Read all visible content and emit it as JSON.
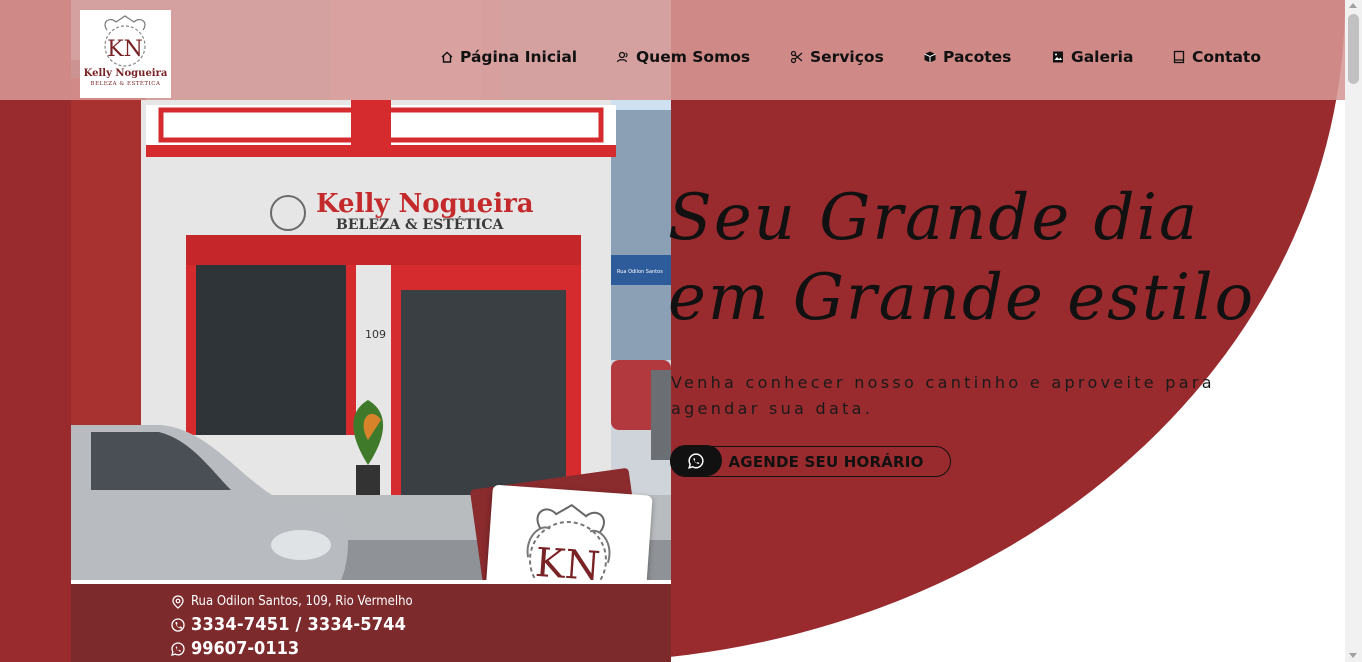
{
  "brand": {
    "name": "Kelly Nogueira",
    "tagline": "BELEZA & ESTÉTICA",
    "monogram": "KN"
  },
  "nav": {
    "items": [
      {
        "label": "Página Inicial",
        "icon": "home-icon"
      },
      {
        "label": "Quem Somos",
        "icon": "people-icon"
      },
      {
        "label": "Serviços",
        "icon": "scissors-icon"
      },
      {
        "label": "Pacotes",
        "icon": "package-icon"
      },
      {
        "label": "Galeria",
        "icon": "gallery-icon"
      },
      {
        "label": "Contato",
        "icon": "book-icon"
      }
    ]
  },
  "hero": {
    "headline_line1": "Seu Grande dia",
    "headline_line2": "em Grande estilo",
    "subtext": "Venha conhecer nosso cantinho e aproveite para agendar sua data.",
    "cta_label": "AGENDE SEU HORÁRIO",
    "cta_icon": "whatsapp-icon"
  },
  "storefront": {
    "sign_name": "Kelly Nogueira",
    "sign_tagline": "BELEZA & ESTÉTICA",
    "street_number": "109",
    "street_sign": "Rua Odilon Santos",
    "address": "Rua Odilon Santos, 109, Rio Vermelho",
    "phones": "3334-7451 / 3334-5744",
    "whatsapp": "99607-0113"
  },
  "colors": {
    "hero_red": "#992a2d",
    "nav_pink": "#d69694",
    "text_dark": "#111111",
    "white": "#ffffff"
  }
}
